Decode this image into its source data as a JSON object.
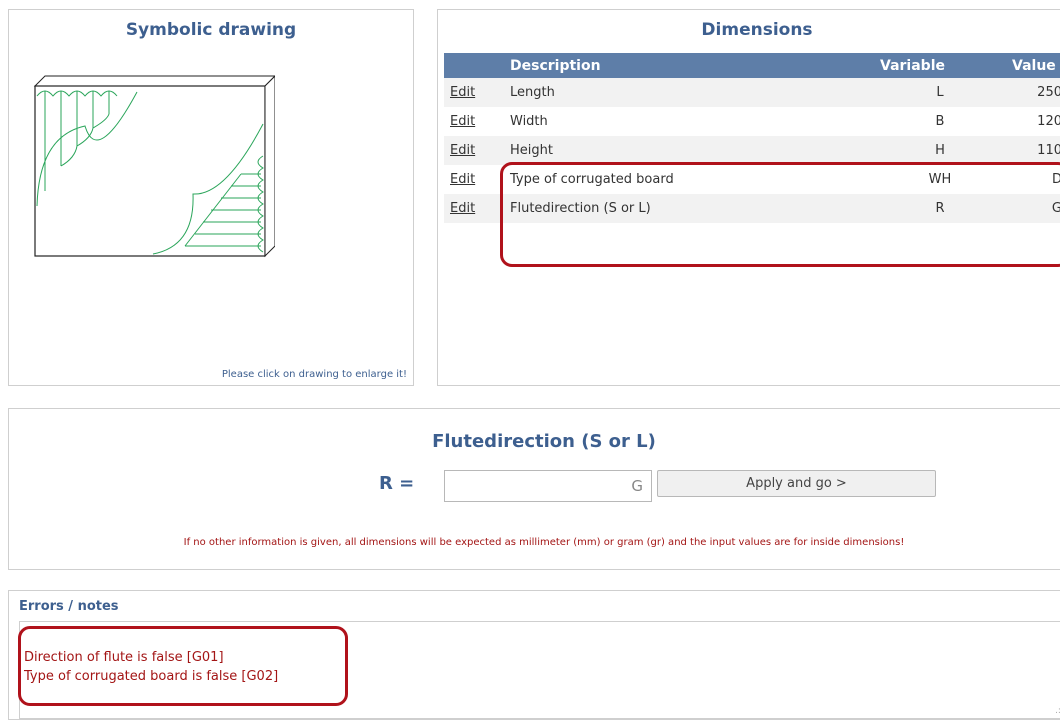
{
  "drawing_panel": {
    "title": "Symbolic drawing",
    "hint": "Please click on drawing to enlarge it!"
  },
  "dimensions_panel": {
    "title": "Dimensions",
    "headers": {
      "description": "Description",
      "variable": "Variable",
      "value": "Value"
    },
    "rows": [
      {
        "edit": "Edit",
        "description": "Length",
        "variable": "L",
        "value": "250"
      },
      {
        "edit": "Edit",
        "description": "Width",
        "variable": "B",
        "value": "120"
      },
      {
        "edit": "Edit",
        "description": "Height",
        "variable": "H",
        "value": "110"
      },
      {
        "edit": "Edit",
        "description": "Type of corrugated board",
        "variable": "WH",
        "value": "D"
      },
      {
        "edit": "Edit",
        "description": "Flutedirection (S or L)",
        "variable": "R",
        "value": "G"
      }
    ]
  },
  "input_panel": {
    "title": "Flutedirection (S or L)",
    "variable_label": "R =",
    "input_value": "G",
    "apply_label": "Apply and go >",
    "note": "If no other information is given, all dimensions will be expected as millimeter (mm) or gram (gr) and the input values are for inside dimensions!"
  },
  "errors_panel": {
    "title": "Errors / notes",
    "messages": [
      "Direction of flute is false [G01]",
      "Type of corrugated board is false [G02]"
    ]
  },
  "colors": {
    "heading": "#3d5f8f",
    "table_header": "#5e7ea8",
    "error_text": "#a31515",
    "highlight": "#b0121b",
    "drawing_stroke": "#2aa55a"
  }
}
